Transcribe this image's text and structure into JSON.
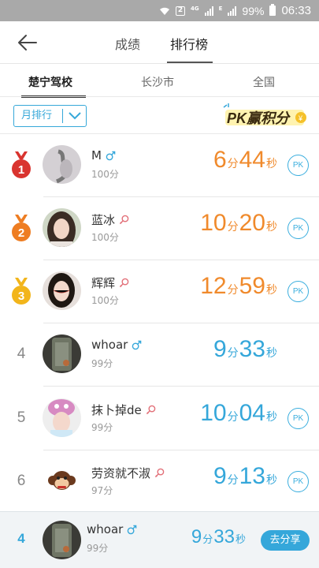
{
  "status_bar": {
    "battery": "99%",
    "time": "06:33",
    "sim_badge": "2",
    "net_a": "4G",
    "net_b": "E"
  },
  "header": {
    "back_icon": "arrow-left-icon",
    "tabs": [
      {
        "label": "成绩",
        "active": false
      },
      {
        "label": "排行榜",
        "active": true
      }
    ]
  },
  "subtabs": [
    {
      "label": "楚宁驾校",
      "active": true
    },
    {
      "label": "长沙市",
      "active": false
    },
    {
      "label": "全国",
      "active": false
    }
  ],
  "filter": {
    "period": "月排行",
    "banner_text": "PK赢积分"
  },
  "colors": {
    "accent": "#35a7da",
    "orange": "#f08a2c",
    "gold": "#f2b51b",
    "red": "#d9342f",
    "bronze": "#ee7d22"
  },
  "rows": [
    {
      "rank": "1",
      "medal": "gold-medal-red",
      "name": "M",
      "gender": "male",
      "score": "100分",
      "min": "6",
      "min_unit": "分",
      "sec": "44",
      "sec_unit": "秒",
      "color": "orange",
      "pk": "PK"
    },
    {
      "rank": "2",
      "medal": "bronze-medal",
      "name": "蓝冰",
      "gender": "female",
      "score": "100分",
      "min": "10",
      "min_unit": "分",
      "sec": "20",
      "sec_unit": "秒",
      "color": "orange",
      "pk": "PK"
    },
    {
      "rank": "3",
      "medal": "gold-medal",
      "name": "辉辉",
      "gender": "female",
      "score": "100分",
      "min": "12",
      "min_unit": "分",
      "sec": "59",
      "sec_unit": "秒",
      "color": "orange",
      "pk": "PK"
    },
    {
      "rank": "4",
      "name": "whoar",
      "gender": "male",
      "score": "99分",
      "min": "9",
      "min_unit": "分",
      "sec": "33",
      "sec_unit": "秒",
      "color": "blue",
      "pk": ""
    },
    {
      "rank": "5",
      "name": "抹卜掉de",
      "gender": "female",
      "score": "99分",
      "min": "10",
      "min_unit": "分",
      "sec": "04",
      "sec_unit": "秒",
      "color": "blue",
      "pk": "PK"
    },
    {
      "rank": "6",
      "name": "劳资就不淑",
      "gender": "female",
      "score": "97分",
      "min": "9",
      "min_unit": "分",
      "sec": "13",
      "sec_unit": "秒",
      "color": "blue",
      "pk": "PK"
    }
  ],
  "me": {
    "rank": "4",
    "name": "whoar",
    "gender": "male",
    "score": "99分",
    "min": "9",
    "min_unit": "分",
    "sec": "33",
    "sec_unit": "秒",
    "share": "去分享"
  }
}
